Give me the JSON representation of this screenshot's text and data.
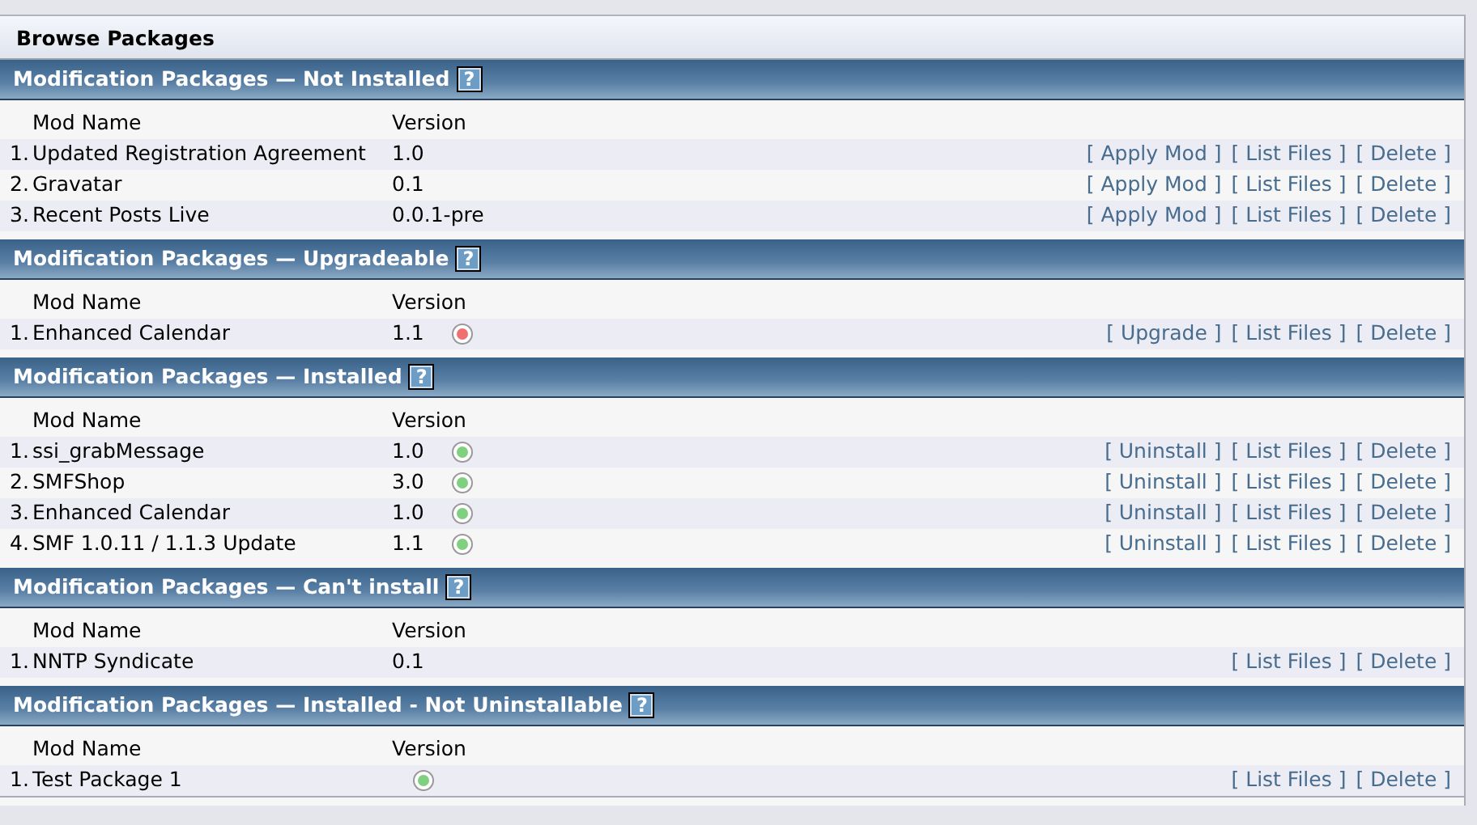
{
  "title": "Browse Packages",
  "sections": [
    {
      "title": "Modification Packages — Not Installed",
      "help": "?",
      "columns": [
        "Mod Name",
        "Version"
      ],
      "rows": [
        {
          "num": "1.",
          "name": "Updated Registration Agreement",
          "version": "1.0",
          "actions": [
            "[ Apply Mod ]",
            "[ List Files ]",
            "[ Delete ]"
          ]
        },
        {
          "num": "2.",
          "name": "Gravatar",
          "version": "0.1",
          "actions": [
            "[ Apply Mod ]",
            "[ List Files ]",
            "[ Delete ]"
          ]
        },
        {
          "num": "3.",
          "name": "Recent Posts Live",
          "version": "0.0.1-pre",
          "actions": [
            "[ Apply Mod ]",
            "[ List Files ]",
            "[ Delete ]"
          ]
        }
      ]
    },
    {
      "title": "Modification Packages — Upgradeable",
      "help": "?",
      "columns": [
        "Mod Name",
        "Version"
      ],
      "rows": [
        {
          "num": "1.",
          "name": "Enhanced Calendar",
          "version": "1.1",
          "color": "#f07070",
          "actions": [
            "[ Upgrade ]",
            "[ List Files ]",
            "[ Delete ]"
          ]
        }
      ]
    },
    {
      "title": "Modification Packages — Installed",
      "help": "?",
      "columns": [
        "Mod Name",
        "Version"
      ],
      "rows": [
        {
          "num": "1.",
          "name": "ssi_grabMessage",
          "version": "1.0",
          "color": "#80d080",
          "actions": [
            "[ Uninstall ]",
            "[ List Files ]",
            "[ Delete ]"
          ]
        },
        {
          "num": "2.",
          "name": "SMFShop",
          "version": "3.0",
          "color": "#80d080",
          "actions": [
            "[ Uninstall ]",
            "[ List Files ]",
            "[ Delete ]"
          ]
        },
        {
          "num": "3.",
          "name": "Enhanced Calendar",
          "version": "1.0",
          "color": "#80d080",
          "actions": [
            "[ Uninstall ]",
            "[ List Files ]",
            "[ Delete ]"
          ]
        },
        {
          "num": "4.",
          "name": "SMF 1.0.11 / 1.1.3 Update",
          "version": "1.1",
          "color": "#80d080",
          "actions": [
            "[ Uninstall ]",
            "[ List Files ]",
            "[ Delete ]"
          ]
        }
      ]
    },
    {
      "title": "Modification Packages — Can't install",
      "help": "?",
      "columns": [
        "Mod Name",
        "Version"
      ],
      "rows": [
        {
          "num": "1.",
          "name": "NNTP Syndicate",
          "version": "0.1",
          "actions": [
            "[ List Files ]",
            "[ Delete ]"
          ]
        }
      ]
    },
    {
      "title": "Modification Packages — Installed - Not Uninstallable",
      "help": "?",
      "columns": [
        "Mod Name",
        "Version"
      ],
      "rows": [
        {
          "num": "1.",
          "name": "Test Package 1",
          "color": "#80d080",
          "actions": [
            "[ List Files ]",
            "[ Delete ]"
          ]
        }
      ]
    }
  ]
}
